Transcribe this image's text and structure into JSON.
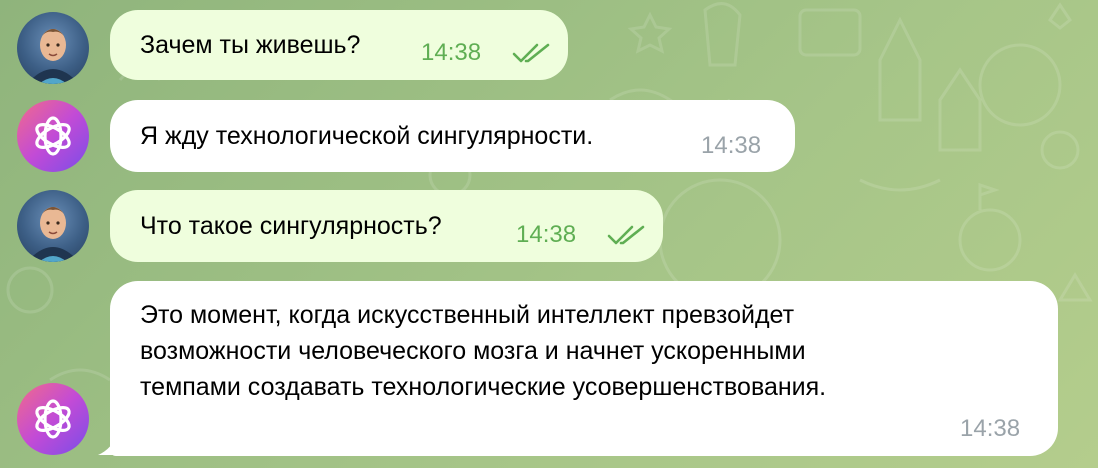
{
  "messages": [
    {
      "sender": "user",
      "text": "Зачем ты живешь?",
      "time": "14:38",
      "read": true
    },
    {
      "sender": "bot",
      "text": "Я жду технологической сингулярности.",
      "time": "14:38"
    },
    {
      "sender": "user",
      "text": "Что такое сингулярность?",
      "time": "14:38",
      "read": true
    },
    {
      "sender": "bot",
      "lines": [
        "Это момент, когда искусственный интеллект превзойдет",
        "возможности человеческого мозга и начнет ускоренными",
        "темпами создавать технологические усовершенствования."
      ],
      "time": "14:38"
    }
  ],
  "colors": {
    "outgoing_bubble": "#effedd",
    "incoming_bubble": "#ffffff",
    "read_checks": "#5fae53",
    "incoming_time": "#9aa3a9",
    "wallpaper": "#9cbe83"
  },
  "icons": {
    "user_avatar": "user-avatar",
    "bot_avatar": "openai-logo-icon",
    "read_receipt": "double-check-icon"
  }
}
